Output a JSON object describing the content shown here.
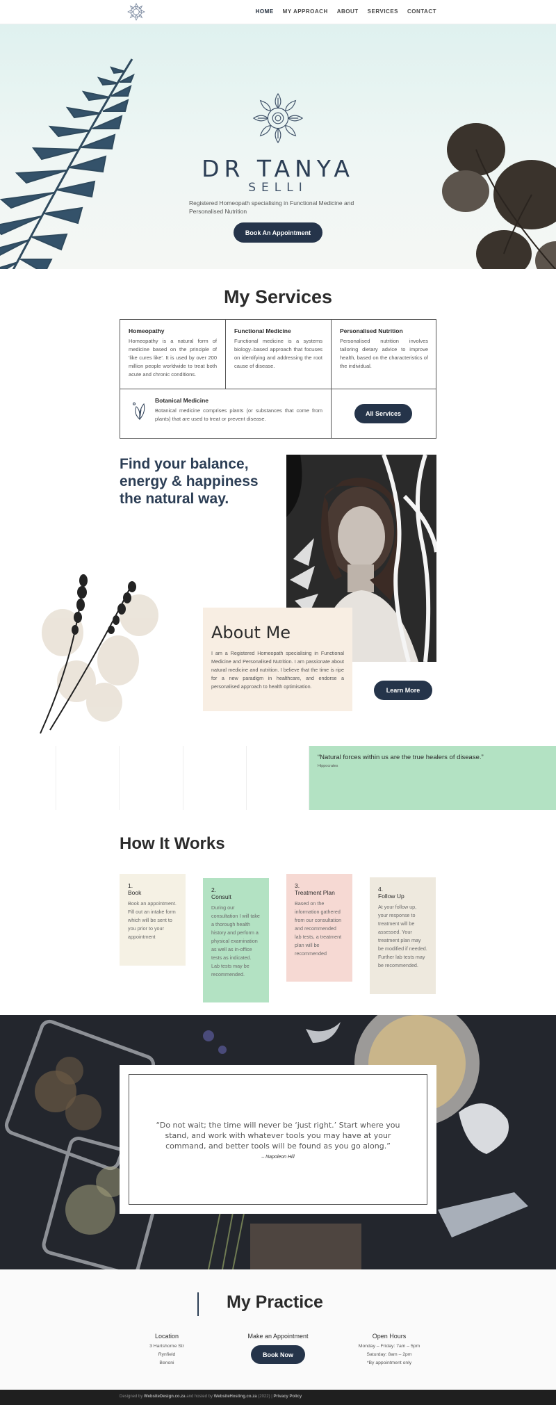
{
  "nav": {
    "logo_icon": "mandala-icon",
    "items": [
      "HOME",
      "MY APPROACH",
      "ABOUT",
      "SERVICES",
      "CONTACT"
    ]
  },
  "hero": {
    "title": "DR TANYA",
    "subtitle": "SELLI",
    "tagline": "Registered Homeopath specialising in Functional Medicine and Personalised Nutrition",
    "button": "Book An Appointment"
  },
  "services": {
    "title": "My Services",
    "items": [
      {
        "name": "Homeopathy",
        "desc": "Homeopathy is a natural form of medicine based on the principle of 'like cures like'. It is used by over 200 million people worldwide to treat both acute and chronic conditions."
      },
      {
        "name": "Functional Medicine",
        "desc": "Functional medicine is a systems biology–based approach that focuses on identifying and addressing the root cause of disease."
      },
      {
        "name": "Personalised Nutrition",
        "desc": "Personalised nutrition involves tailoring dietary advice to improve health, based on the characteristics of the individual."
      },
      {
        "name": "Botanical Medicine",
        "desc": "Botanical medicine comprises plants (or substances that come from plants) that are used to treat or prevent disease."
      }
    ],
    "button": "All Services"
  },
  "about": {
    "headline": "Find your balance, energy & happiness the natural way.",
    "title": "About Me",
    "text": "I am a Registered Homeopath specialising in Functional Medicine and Personalised Nutrition. I am passionate about natural medicine and nutrition. I believe that the time is ripe for a new paradigm in healthcare, and endorse a personalised approach to health optimisation.",
    "button": "Learn More"
  },
  "band_quote": {
    "text": "“Natural forces within us are the true healers of disease.”",
    "author": "Hippocrates"
  },
  "how_it_works": {
    "title": "How It Works",
    "steps": [
      {
        "num": "1.",
        "title": "Book",
        "desc": "Book an appointment. Fill out an intake form which will be sent to you prior to your appointment",
        "color": "#f5f1e4"
      },
      {
        "num": "2.",
        "title": "Consult",
        "desc": "During our consultation I will take a thorough health history and perform a physical examination as well as in-office tests as indicated. Lab tests may be recommended.",
        "color": "#b3e2c3"
      },
      {
        "num": "3.",
        "title": "Treatment Plan",
        "desc": "Based on the information gathered from our consultation and recommended lab tests, a treatment plan will be recommended",
        "color": "#f6d9d3"
      },
      {
        "num": "4.",
        "title": "Follow Up",
        "desc": "At your follow up, your response to treatment will be assessed. Your treatment plan may be modified if needed. Further lab tests may be recommended.",
        "color": "#eee9de"
      }
    ]
  },
  "testimonial": {
    "text": "“Do not wait; the time will never be ‘just right.’ Start where you stand, and work with whatever tools you may have at your command, and better tools will be found as you go along.”",
    "author": "– Napoleon Hill"
  },
  "practice": {
    "title": "My Practice",
    "location": {
      "heading": "Location",
      "lines": [
        "3 Hartshorne Str",
        "Rynfield",
        "Benoni"
      ]
    },
    "appointment": {
      "heading": "Make an Appointment",
      "button": "Book Now"
    },
    "hours": {
      "heading": "Open Hours",
      "lines": [
        "Monday – Friday: 7am – 5pm",
        "Saturday: 8am – 2pm",
        "*By appointment only"
      ]
    }
  },
  "footer": {
    "prefix": "Designed by",
    "designer": "WebsiteDesign.co.za",
    "middle": "and hosted by",
    "host": "WebsiteHosting.co.za",
    "year": "(2022) |",
    "privacy": "Privacy Policy"
  }
}
